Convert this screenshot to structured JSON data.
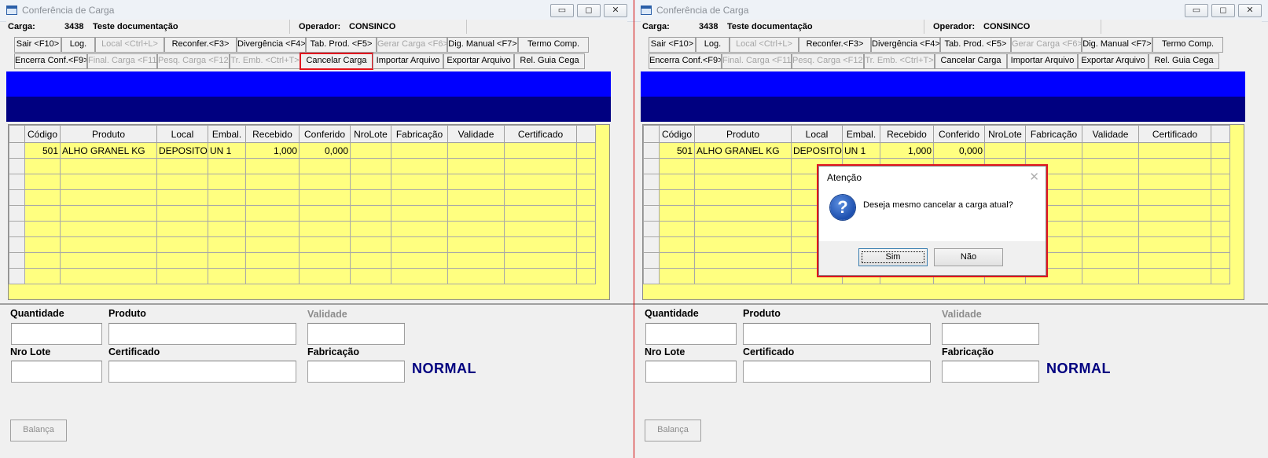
{
  "window": {
    "title": "Conferência de Carga",
    "controls": [
      "▭",
      "◻",
      "✕"
    ]
  },
  "info": {
    "carga_label": "Carga:",
    "carga_number": "3438",
    "carga_desc": "Teste documentação",
    "operador_label": "Operador:",
    "operador_value": "CONSINCO"
  },
  "toolbar": {
    "row1": [
      {
        "label": "Sair <F10>",
        "enabled": true
      },
      {
        "label": "Log.",
        "enabled": true
      },
      {
        "label": "Local <Ctrl+L>",
        "enabled": false
      },
      {
        "label": "Reconfer.<F3>",
        "enabled": true
      },
      {
        "label": "Divergência <F4>",
        "enabled": true
      },
      {
        "label": "Tab. Prod. <F5>",
        "enabled": true
      },
      {
        "label": "Gerar Carga <F6>",
        "enabled": false
      },
      {
        "label": "Dig. Manual <F7>",
        "enabled": true
      },
      {
        "label": "Termo Comp.",
        "enabled": true
      }
    ],
    "row2": [
      {
        "label": "Encerra Conf.<F9>",
        "enabled": true
      },
      {
        "label": "Final. Carga <F11>",
        "enabled": false
      },
      {
        "label": "Pesq. Carga <F12>",
        "enabled": false
      },
      {
        "label": "Tr. Emb. <Ctrl+T>",
        "enabled": false
      },
      {
        "label": "Cancelar Carga",
        "enabled": true
      },
      {
        "label": "Importar Arquivo",
        "enabled": true
      },
      {
        "label": "Exportar Arquivo",
        "enabled": true
      },
      {
        "label": "Rel. Guia Cega",
        "enabled": true
      }
    ]
  },
  "grid": {
    "columns": [
      "Código",
      "Produto",
      "Local",
      "Embal.",
      "Recebido",
      "Conferido",
      "NroLote",
      "Fabricação",
      "Validade",
      "Certificado"
    ],
    "rows": [
      [
        "501",
        "ALHO GRANEL KG",
        "DEPOSITO",
        "UN  1",
        "1,000",
        "0,000",
        "",
        "",
        "",
        ""
      ]
    ]
  },
  "form": {
    "quantidade_label": "Quantidade",
    "produto_label": "Produto",
    "validade_label": "Validade",
    "nro_lote_label": "Nro Lote",
    "certificado_label": "Certificado",
    "fabricacao_label": "Fabricação",
    "status": "NORMAL",
    "balanca_label": "Balança"
  },
  "dialog": {
    "title": "Atenção",
    "message": "Deseja mesmo cancelar a carga atual?",
    "yes_label": "Sim",
    "no_label": "Não",
    "close_glyph": "✕",
    "icon_glyph": "?"
  },
  "colors": {
    "highlight": "#e0141e",
    "grid_bg": "#ffff80",
    "band_top": "#0000ff",
    "band_bottom": "#000080",
    "status_text": "#000080"
  }
}
